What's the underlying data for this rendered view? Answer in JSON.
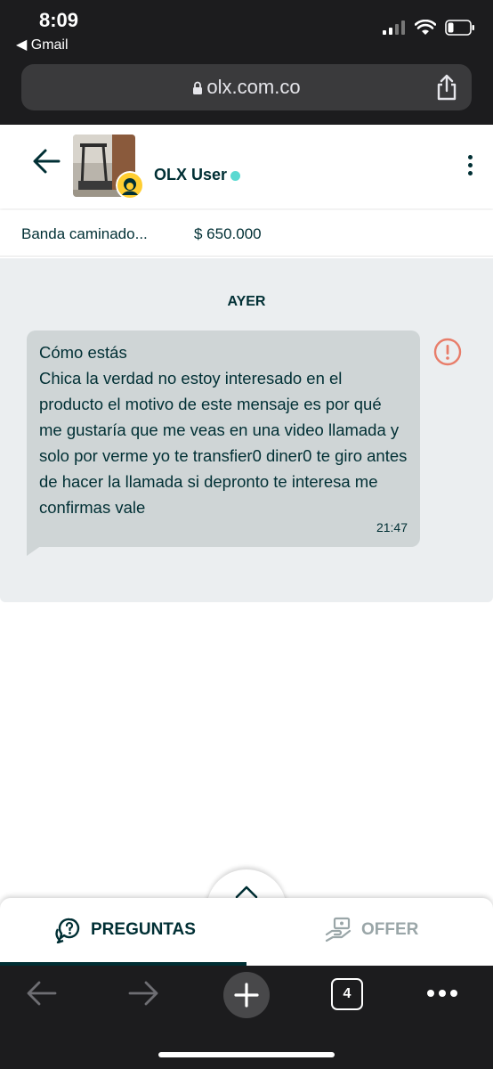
{
  "status_bar": {
    "time": "8:09",
    "back_app": "◀ Gmail"
  },
  "browser": {
    "url": "olx.com.co"
  },
  "chat_header": {
    "user_name": "OLX User",
    "online": true
  },
  "product": {
    "name": "Banda caminado...",
    "price": "$ 650.000"
  },
  "chat": {
    "day_label": "AYER",
    "messages": [
      {
        "text": "Cómo estás\nChica la verdad no estoy interesado en el producto el motivo de este mensaje es por qué me gustaría que me veas en una video llamada y solo por verme yo te transfier0 diner0 te giro antes de hacer la llamada si depronto te interesa me confirmas vale",
        "time": "21:47"
      }
    ]
  },
  "tabs": {
    "preguntas": "PREGUNTAS",
    "offer": "OFFER",
    "active": "preguntas"
  },
  "toolbar": {
    "tab_count": "4"
  },
  "colors": {
    "primary": "#002f34",
    "bubble": "#cfd5d6",
    "chat_bg": "#ebeef0",
    "online": "#5ad9d1",
    "info": "#e87d6a",
    "chrome": "#1c1c1e"
  }
}
